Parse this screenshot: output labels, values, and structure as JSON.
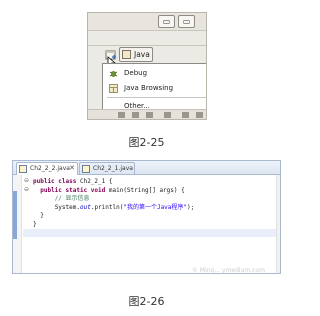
{
  "figure1": {
    "window_buttons": [
      "▭",
      "▭"
    ],
    "perspective_button_label": "Java",
    "menu_items": [
      "Debug",
      "Java Browsing",
      "Other..."
    ]
  },
  "caption1": "图2-25",
  "figure2": {
    "tabs": [
      "Ch2_2_2.java",
      "Ch2_2_1.java"
    ],
    "tab_close": "✕",
    "fold_markers": [
      "⊖",
      "⊖"
    ],
    "code": {
      "line1_kw": "public class ",
      "line1_rest": "Ch2_2_1 {",
      "line2_kw1": "public static void ",
      "line2_rest": "main(String[] args) {",
      "line3_comment": "// 显示信息",
      "line4_a": "System.",
      "line4_field": "out",
      "line4_b": ".println(",
      "line4_string": "\"我的第一个Java程序\"",
      "line4_c": ");",
      "line5": "}",
      "line6": "}"
    }
  },
  "caption2": "图2-26",
  "watermark": "© Ming... ymedium.com"
}
